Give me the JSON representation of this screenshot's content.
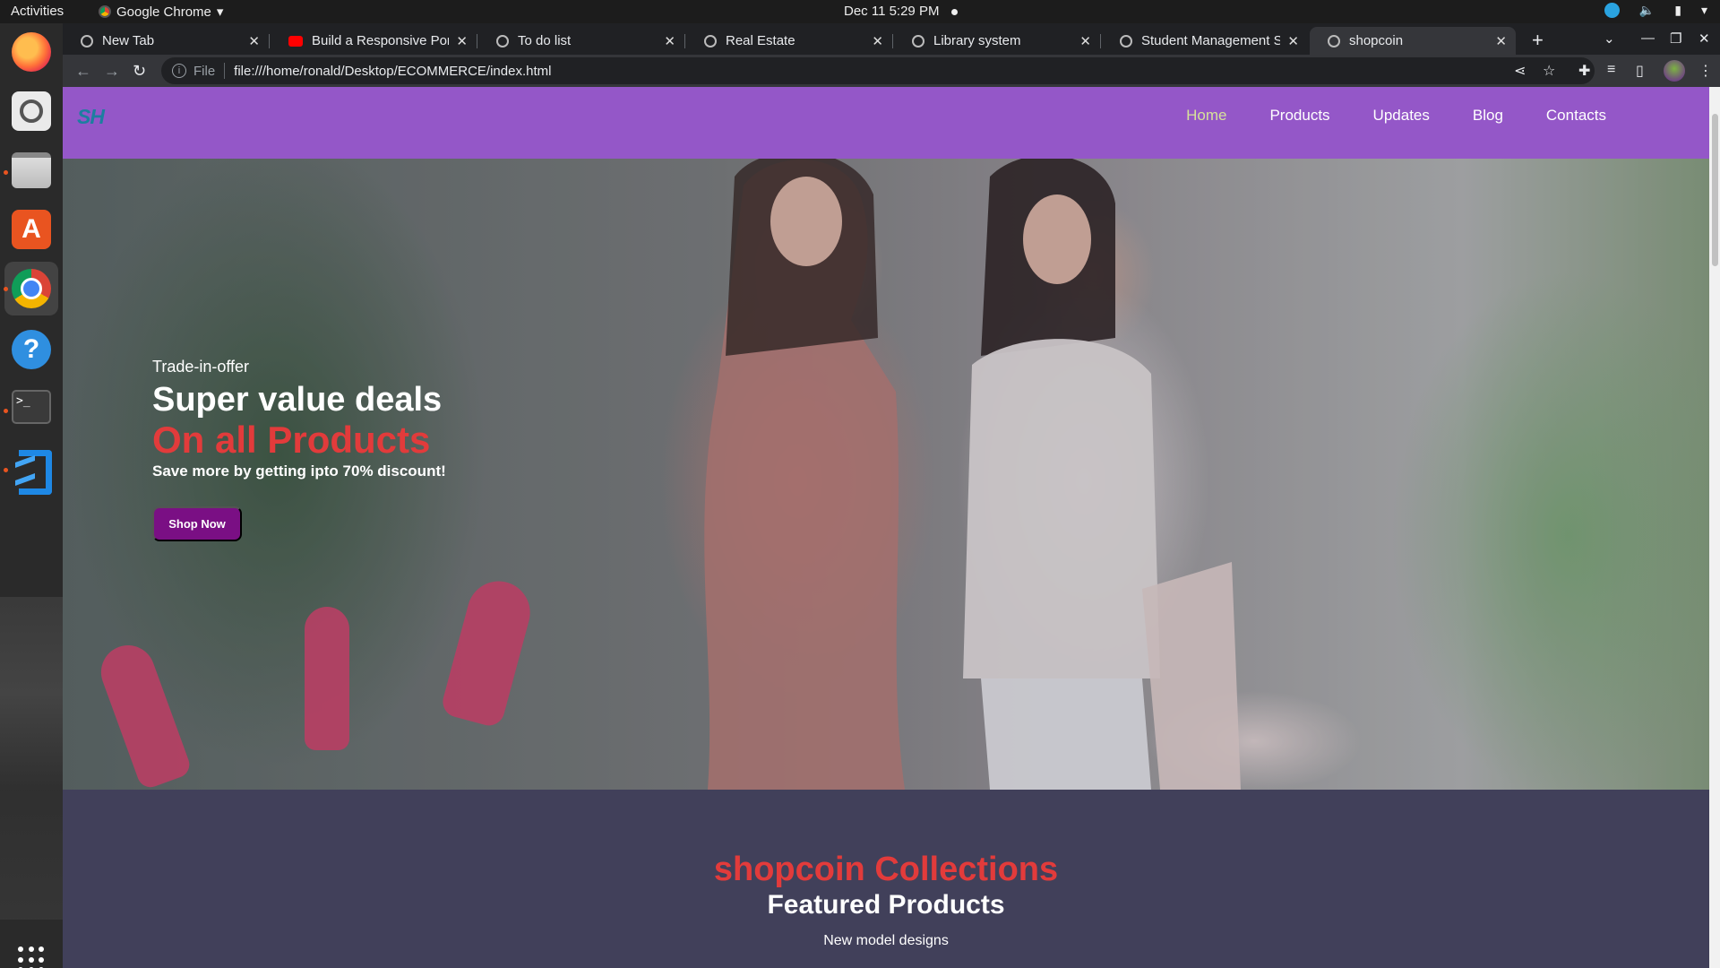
{
  "system": {
    "activities": "Activities",
    "app_name": "Google Chrome",
    "clock": "Dec 11   5:29 PM"
  },
  "browser": {
    "tabs": [
      {
        "title": "New Tab",
        "favicon": "chrome-icon"
      },
      {
        "title": "Build a Responsive Portf",
        "favicon": "youtube-icon"
      },
      {
        "title": "To do list",
        "favicon": "globe-icon"
      },
      {
        "title": "Real Estate",
        "favicon": "globe-icon"
      },
      {
        "title": "Library system",
        "favicon": "globe-icon"
      },
      {
        "title": "Student Management Sy",
        "favicon": "globe-icon"
      },
      {
        "title": "shopcoin",
        "favicon": "globe-icon",
        "active": true
      }
    ],
    "address": {
      "scheme_label": "File",
      "url": "file:///home/ronald/Desktop/ECOMMERCE/index.html"
    }
  },
  "site": {
    "logo": "SH",
    "nav": [
      {
        "label": "Home",
        "active": true
      },
      {
        "label": "Products"
      },
      {
        "label": "Updates"
      },
      {
        "label": "Blog"
      },
      {
        "label": "Contacts"
      }
    ],
    "hero": {
      "kicker": "Trade-in-offer",
      "headline": "Super value deals",
      "highlight": "On all Products",
      "subtext": "Save more by getting ipto 70% discount!",
      "cta": "Shop Now"
    },
    "featured": {
      "brand_title": "shopcoin Collections",
      "heading": "Featured Products",
      "subheading": "New model designs"
    },
    "colors": {
      "header_bg": "#9457c8",
      "nav_active": "#d6e29a",
      "accent_red": "#e23b3b",
      "cta_bg": "#7a0f84",
      "section_bg": "#41405a"
    }
  }
}
